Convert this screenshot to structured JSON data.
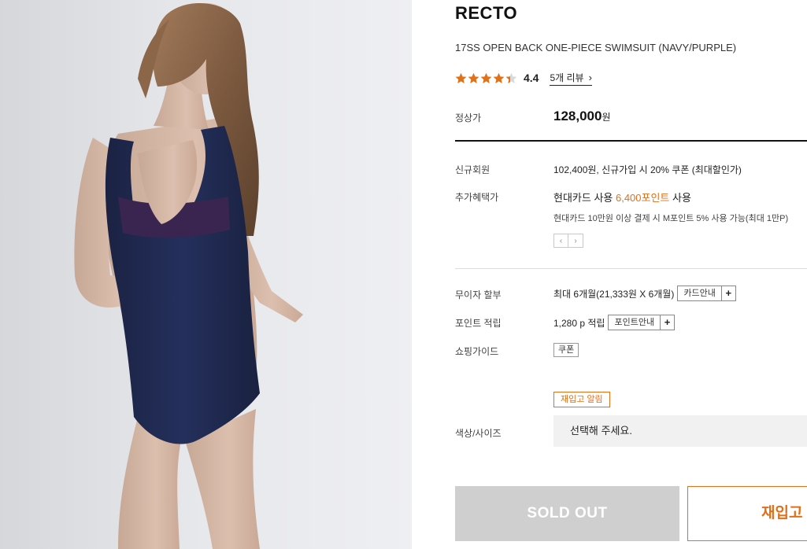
{
  "product": {
    "brand": "RECTO",
    "name": "17SS OPEN BACK ONE-PIECE SWIMSUIT (NAVY/PURPLE)",
    "rating": "4.4",
    "rating_value": 4.4,
    "rating_max": 5,
    "review_link": "5개 리뷰"
  },
  "price": {
    "label": "정상가",
    "amount": "128,000",
    "unit": "원"
  },
  "benefits": {
    "new_member_label": "신규회원",
    "new_member_value": "102,400원, 신규가입 시 20% 쿠폰 (최대할인가)",
    "extra_label": "추가혜택가",
    "extra_prefix": "현대카드 사용 ",
    "extra_highlight": "6,400포인트",
    "extra_suffix": " 사용",
    "extra_note": "현대카드 10만원 이상 결제 시 M포인트 5% 사용 가능(최대 1만P)",
    "prev_arrow": "‹",
    "next_arrow": "›"
  },
  "installment": {
    "label": "무이자 할부",
    "value": "최대 6개월(21,333원 X 6개월)",
    "button": "카드안내"
  },
  "points": {
    "label": "포인트 적립",
    "value": "1,280 p 적립",
    "button": "포인트안내"
  },
  "guide": {
    "label": "쇼핑가이드",
    "chip": "쿠폰"
  },
  "option": {
    "restock_chip": "재입고 알림",
    "label": "색상/사이즈",
    "placeholder": "선택해 주세요."
  },
  "actions": {
    "soldout": "SOLD OUT",
    "restock": "재입고 알림"
  },
  "colors": {
    "accent": "#e0701a",
    "star": "#e0701a",
    "soldout_bg": "#cfcfcf"
  },
  "icons": {
    "review_chevron": "chevron-right-icon",
    "plus": "plus-icon"
  }
}
